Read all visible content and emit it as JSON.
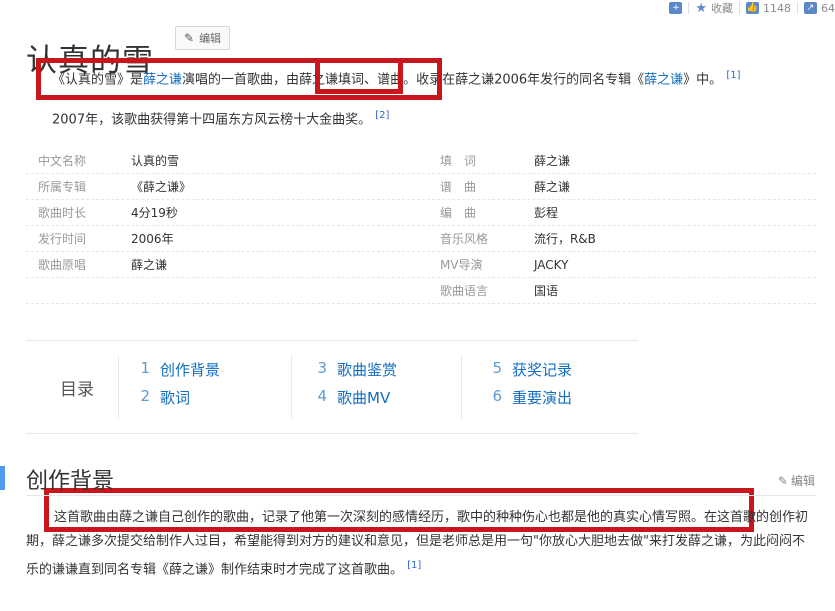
{
  "toolbar": {
    "collect_label": "收藏",
    "like_count": "1148",
    "share_count": "64"
  },
  "title": "认真的雪",
  "edit_label": "编辑",
  "intro": {
    "p1_a": "《认真的雪》是",
    "p1_link1": "薛之谦",
    "p1_b": "演唱的一首歌曲，由",
    "p1_c": "薛之谦填词、",
    "p1_d": "谱曲。收录在薛之谦2006年发行的同名专辑《",
    "p1_link2": "薛之谦",
    "p1_e": "》中。",
    "p1_ref": "[1]",
    "p2": "2007年，该歌曲获得第十四届东方风云榜十大金曲奖。",
    "p2_ref": "[2]"
  },
  "info": {
    "rows": [
      {
        "l1": "中文名称",
        "v1": "认真的雪",
        "l2": "填　词",
        "v2": "薛之谦"
      },
      {
        "l1": "所属专辑",
        "v1": "《薛之谦》",
        "l2": "谱　曲",
        "v2": "薛之谦"
      },
      {
        "l1": "歌曲时长",
        "v1": "4分19秒",
        "l2": "编　曲",
        "v2": "彭程"
      },
      {
        "l1": "发行时间",
        "v1": "2006年",
        "l2": "音乐风格",
        "v2": "流行，R&B"
      },
      {
        "l1": "歌曲原唱",
        "v1": "薛之谦",
        "l2": "MV导演",
        "v2": "JACKY"
      },
      {
        "l1": "",
        "v1": "",
        "l2": "歌曲语言",
        "v2": "国语"
      }
    ]
  },
  "catalog": {
    "label": "目录",
    "items": [
      {
        "num": "1",
        "text": "创作背景"
      },
      {
        "num": "2",
        "text": "歌词"
      },
      {
        "num": "3",
        "text": "歌曲鉴赏"
      },
      {
        "num": "4",
        "text": "歌曲MV"
      },
      {
        "num": "5",
        "text": "获奖记录"
      },
      {
        "num": "6",
        "text": "重要演出"
      }
    ]
  },
  "section": {
    "title": "创作背景",
    "edit_label": "编辑",
    "text": "这首歌曲由薛之谦自己创作的歌曲，记录了他第一次深刻的感情经历，歌中的种种伤心也都是他的真实心情写照。在这首歌的创作初期，薛之谦多次提交给制作人过目，希望能得到对方的建议和意见，但是老师总是用一句\"你放心大胆地去做\"来打发薛之谦，为此闷闷不乐的谦谦直到同名专辑《薛之谦》制作结束时才完成了这首歌曲。",
    "ref": "[1]"
  },
  "colors": {
    "link": "#136ec2",
    "highlight_box": "#c8161d",
    "section_accent": "#4f9cee"
  }
}
